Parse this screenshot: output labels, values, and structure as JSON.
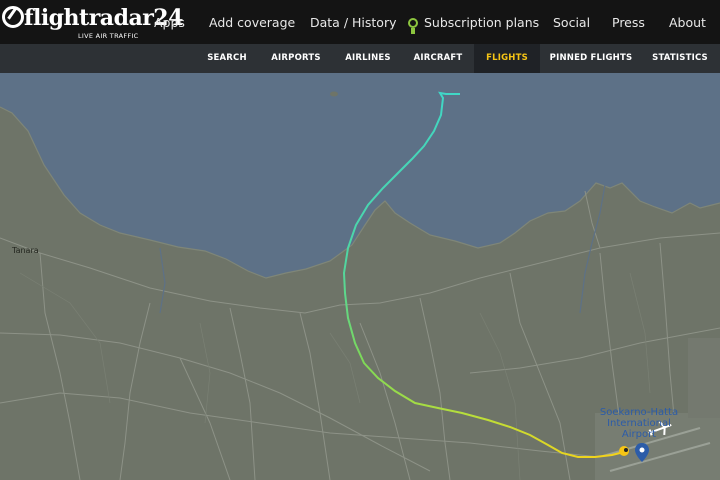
{
  "logo": {
    "brand": "flightradar24",
    "tagline": "LIVE AIR TRAFFIC"
  },
  "top_nav": [
    {
      "label": "Apps"
    },
    {
      "label": "Add coverage"
    },
    {
      "label": "Data / History"
    },
    {
      "label": "Subscription plans",
      "icon": "award-icon"
    },
    {
      "label": "Social"
    },
    {
      "label": "Press"
    },
    {
      "label": "About"
    }
  ],
  "sub_nav": [
    {
      "label": "SEARCH"
    },
    {
      "label": "AIRPORTS"
    },
    {
      "label": "AIRLINES"
    },
    {
      "label": "AIRCRAFT"
    },
    {
      "label": "FLIGHTS",
      "active": true
    },
    {
      "label": "PINNED FLIGHTS"
    },
    {
      "label": "STATISTICS"
    }
  ],
  "map": {
    "place_labels": [
      "Tanara"
    ],
    "airport_label": "Soekarno-Hatta International Airport",
    "colors": {
      "sea": "#5d7187",
      "land": "#6e7468",
      "track_start": "#f2d31a",
      "track_mid": "#7ed957",
      "track_end": "#3fd7c8",
      "accent": "#f6c515"
    }
  }
}
